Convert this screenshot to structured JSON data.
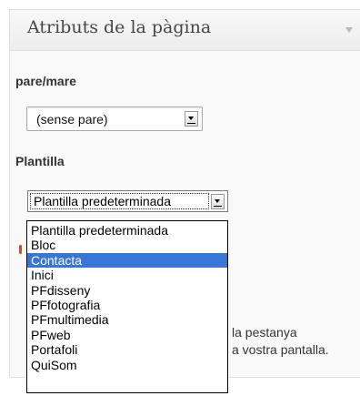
{
  "metabox": {
    "title": "Atributs de la pàgina"
  },
  "parent": {
    "label": "pare/mare",
    "selected": "(sense pare)"
  },
  "template": {
    "label": "Plantilla",
    "selected": "Plantilla predeterminada",
    "options": [
      "Plantilla predeterminada",
      "Bloc",
      "Contacta",
      "Inici",
      "PFdisseny",
      "PFfotografia",
      "PFmultimedia",
      "PFweb",
      "Portafoli",
      "QuiSom"
    ],
    "highlighted_index": 2
  },
  "help": {
    "line1": "la pestanya",
    "line2": "a vostra pantalla."
  },
  "colors": {
    "highlight": "#3875d7",
    "box_border": "#dfdfdf"
  }
}
